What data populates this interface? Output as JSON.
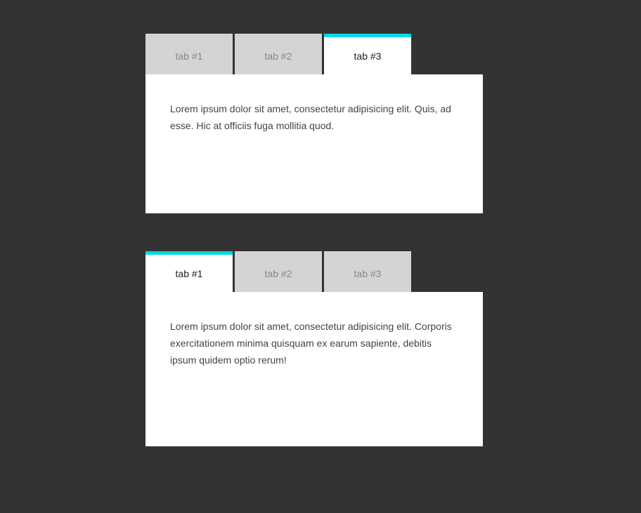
{
  "widgets": [
    {
      "tabs": [
        {
          "label": "tab #1",
          "active": false
        },
        {
          "label": "tab #2",
          "active": false
        },
        {
          "label": "tab #3",
          "active": true
        }
      ],
      "content": "Lorem ipsum dolor sit amet, consectetur adipisicing elit. Quis, ad esse. Hic at officiis fuga mollitia quod."
    },
    {
      "tabs": [
        {
          "label": "tab #1",
          "active": true
        },
        {
          "label": "tab #2",
          "active": false
        },
        {
          "label": "tab #3",
          "active": false
        }
      ],
      "content": "Lorem ipsum dolor sit amet, consectetur adipisicing elit. Corporis exercitationem minima quisquam ex earum sapiente, debitis ipsum quidem optio rerum!"
    }
  ],
  "colors": {
    "accent": "#00d9e6",
    "inactive_bg": "#d4d4d4",
    "page_bg": "#333333"
  }
}
